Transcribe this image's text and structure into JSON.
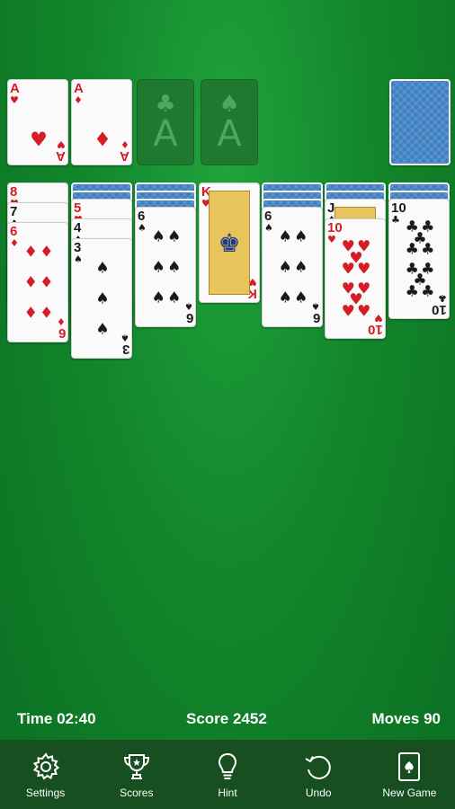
{
  "game": {
    "foundations": [
      {
        "rank": "A",
        "suit": "♥",
        "color": "red"
      },
      {
        "rank": "A",
        "suit": "♦",
        "color": "red"
      },
      {
        "rank": "A",
        "suit": "♣",
        "empty": true
      },
      {
        "rank": "A",
        "suit": "♠",
        "empty": true
      }
    ],
    "stock": {
      "face": "down"
    },
    "tableau": [
      {
        "hidden": 0,
        "cards": [
          {
            "rank": "8",
            "suit": "♥",
            "color": "red"
          },
          {
            "rank": "7",
            "suit": "♠",
            "color": "black"
          },
          {
            "rank": "6",
            "suit": "♦",
            "color": "red"
          }
        ]
      },
      {
        "hidden": 2,
        "cards": [
          {
            "rank": "5",
            "suit": "♥",
            "color": "red"
          },
          {
            "rank": "4",
            "suit": "♠",
            "color": "black"
          },
          {
            "rank": "3",
            "suit": "♠",
            "color": "black"
          }
        ]
      },
      {
        "hidden": 3,
        "cards": [
          {
            "rank": "6",
            "suit": "♠",
            "color": "black"
          }
        ]
      },
      {
        "hidden": 0,
        "cards": [
          {
            "rank": "K",
            "suit": "♥",
            "color": "red"
          }
        ]
      },
      {
        "hidden": 3,
        "cards": [
          {
            "rank": "6",
            "suit": "♠",
            "color": "black"
          }
        ]
      },
      {
        "hidden": 2,
        "cards": [
          {
            "rank": "J",
            "suit": "♠",
            "color": "black"
          },
          {
            "rank": "10",
            "suit": "♥",
            "color": "red"
          }
        ]
      },
      {
        "hidden": 2,
        "cards": [
          {
            "rank": "10",
            "suit": "♣",
            "color": "black"
          }
        ]
      }
    ]
  },
  "status": {
    "time": "Time 02:40",
    "score": "Score 2452",
    "moves": "Moves 90"
  },
  "toolbar": {
    "settings_label": "Settings",
    "scores_label": "Scores",
    "hint_label": "Hint",
    "undo_label": "Undo",
    "new_game_label": "New Game"
  },
  "icons": [
    "gear-icon",
    "trophy-icon",
    "lightbulb-icon",
    "undo-icon",
    "new-game-icon"
  ]
}
